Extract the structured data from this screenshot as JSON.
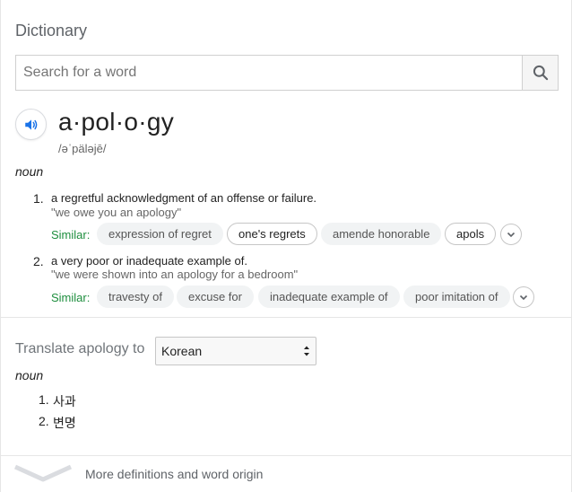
{
  "card": {
    "title": "Dictionary",
    "search": {
      "placeholder": "Search for a word",
      "value": ""
    }
  },
  "entry": {
    "headword": "a·pol·o·gy",
    "phonetic": "/əˈpäləjē/",
    "part_of_speech": "noun",
    "definitions": [
      {
        "number": "1.",
        "text": "a regretful acknowledgment of an offense or failure.",
        "example": "\"we owe you an apology\"",
        "similar_label": "Similar:",
        "similar": [
          "expression of regret",
          "one's regrets",
          "amende honorable",
          "apols"
        ]
      },
      {
        "number": "2.",
        "text": "a very poor or inadequate example of.",
        "example": "\"we were shown into an apology for a bedroom\"",
        "similar_label": "Similar:",
        "similar": [
          "travesty of",
          "excuse for",
          "inadequate example of",
          "poor imitation of"
        ]
      }
    ]
  },
  "translate": {
    "label": "Translate apology to",
    "selected_language": "Korean",
    "part_of_speech": "noun",
    "items": [
      {
        "number": "1.",
        "text": "사과"
      },
      {
        "number": "2.",
        "text": "변명"
      }
    ]
  },
  "footer": {
    "more_label": "More definitions and word origin"
  },
  "colors": {
    "similar_green": "#1e8e3e",
    "icon_blue": "#1a73e8",
    "muted": "#5f6368"
  }
}
